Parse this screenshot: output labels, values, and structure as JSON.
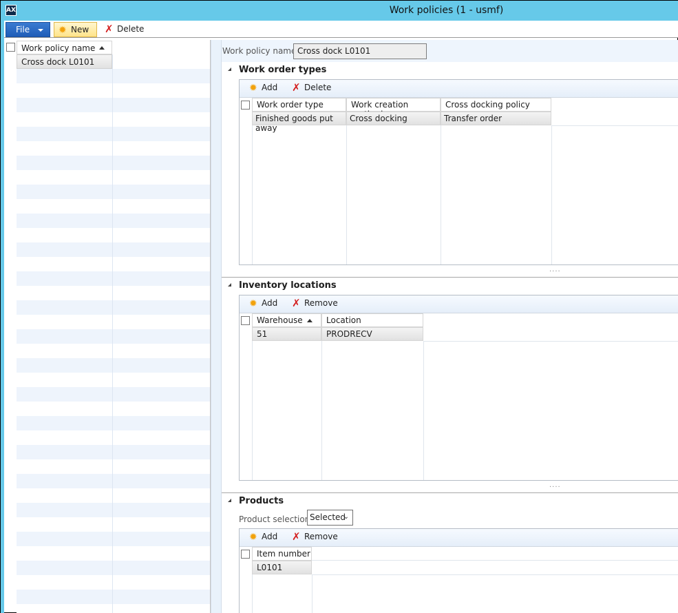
{
  "window": {
    "title": "Work policies (1 - usmf)",
    "app_icon": "dynamics-ax-icon"
  },
  "action_pane": {
    "file_label": "File",
    "new_label": "New",
    "delete_label": "Delete"
  },
  "list": {
    "column_header": "Work policy name",
    "sort": "ascending",
    "rows": [
      "Cross dock L0101"
    ],
    "selected_index": 0
  },
  "detail": {
    "policy_name_label": "Work policy name:",
    "policy_name_value": "Cross dock L0101",
    "work_order_types": {
      "title": "Work order types",
      "add_label": "Add",
      "delete_label": "Delete",
      "columns": [
        "Work order type",
        "Work creation method",
        "Cross docking policy name"
      ],
      "rows": [
        [
          "Finished goods put away",
          "Cross docking",
          "Transfer order"
        ]
      ]
    },
    "inventory_locations": {
      "title": "Inventory locations",
      "add_label": "Add",
      "remove_label": "Remove",
      "columns": [
        "Warehouse",
        "Location"
      ],
      "sort_column": "Warehouse",
      "rows": [
        [
          "51",
          "PRODRECV"
        ]
      ]
    },
    "products": {
      "title": "Products",
      "selection_label": "Product selection:",
      "selection_value": "Selected",
      "add_label": "Add",
      "remove_label": "Remove",
      "columns": [
        "Item number"
      ],
      "rows": [
        [
          "L0101"
        ]
      ]
    }
  },
  "colors": {
    "titlebar": "#66c9e9",
    "file_button": "#2a6cc6",
    "new_button": "#ffe48a",
    "delete_icon": "#d42020",
    "add_icon": "#f2a20c",
    "alt_row": "#eef4fc"
  }
}
